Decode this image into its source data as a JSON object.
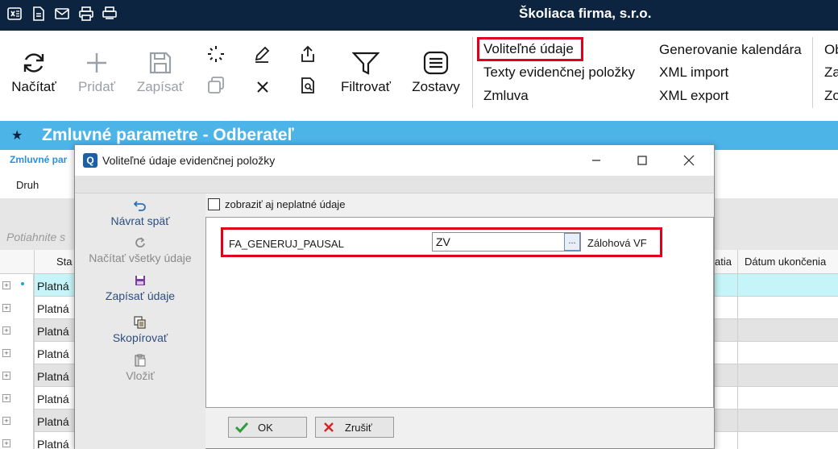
{
  "app": {
    "company": "Školiaca firma, s.r.o."
  },
  "toolbar_icons": [
    "excel-icon",
    "document-icon",
    "mail-icon",
    "print-icon",
    "print-preview-icon"
  ],
  "ribbon": {
    "refresh": "Načítať",
    "add": "Pridať",
    "save": "Zapísať",
    "filter": "Filtrovať",
    "reports": "Zostavy",
    "links_col1": [
      "Voliteľné údaje",
      "Texty evidenčnej položky",
      "Zmluva"
    ],
    "links_col2": [
      "Generovanie kalendára",
      "XML import",
      "XML export"
    ],
    "links_col3": [
      "Ob",
      "Za",
      "Zo"
    ]
  },
  "page": {
    "title": "Zmluvné parametre - Odberateľ",
    "breadcrumb": "Zmluvné par",
    "druh_label": "Druh",
    "drag_hint": "Potiahnite s"
  },
  "grid": {
    "headers": [
      "Sta",
      "atia",
      "Dátum ukončenia"
    ],
    "rows": [
      "Platná",
      "Platná",
      "Platná",
      "Platná",
      "Platná",
      "Platná",
      "Platná",
      "Platná"
    ]
  },
  "dialog": {
    "title": "Voliteľné údaje evidenčnej položky",
    "actions": [
      "Návrat späť",
      "Načítať všetky údaje",
      "Zapísať údaje",
      "Skopírovať",
      "Vložiť"
    ],
    "checkbox_label": "zobraziť aj neplatné údaje",
    "field": {
      "name": "FA_GENERUJ_PAUSAL",
      "value": "ZV",
      "lookup": "...",
      "description": "Zálohová VF"
    },
    "ok": "OK",
    "cancel": "Zrušiť"
  },
  "colors": {
    "topbar": "#0d2440",
    "titleband": "#4db4e8",
    "highlight": "#e0001b",
    "selected_row": "#c5f5f8"
  }
}
